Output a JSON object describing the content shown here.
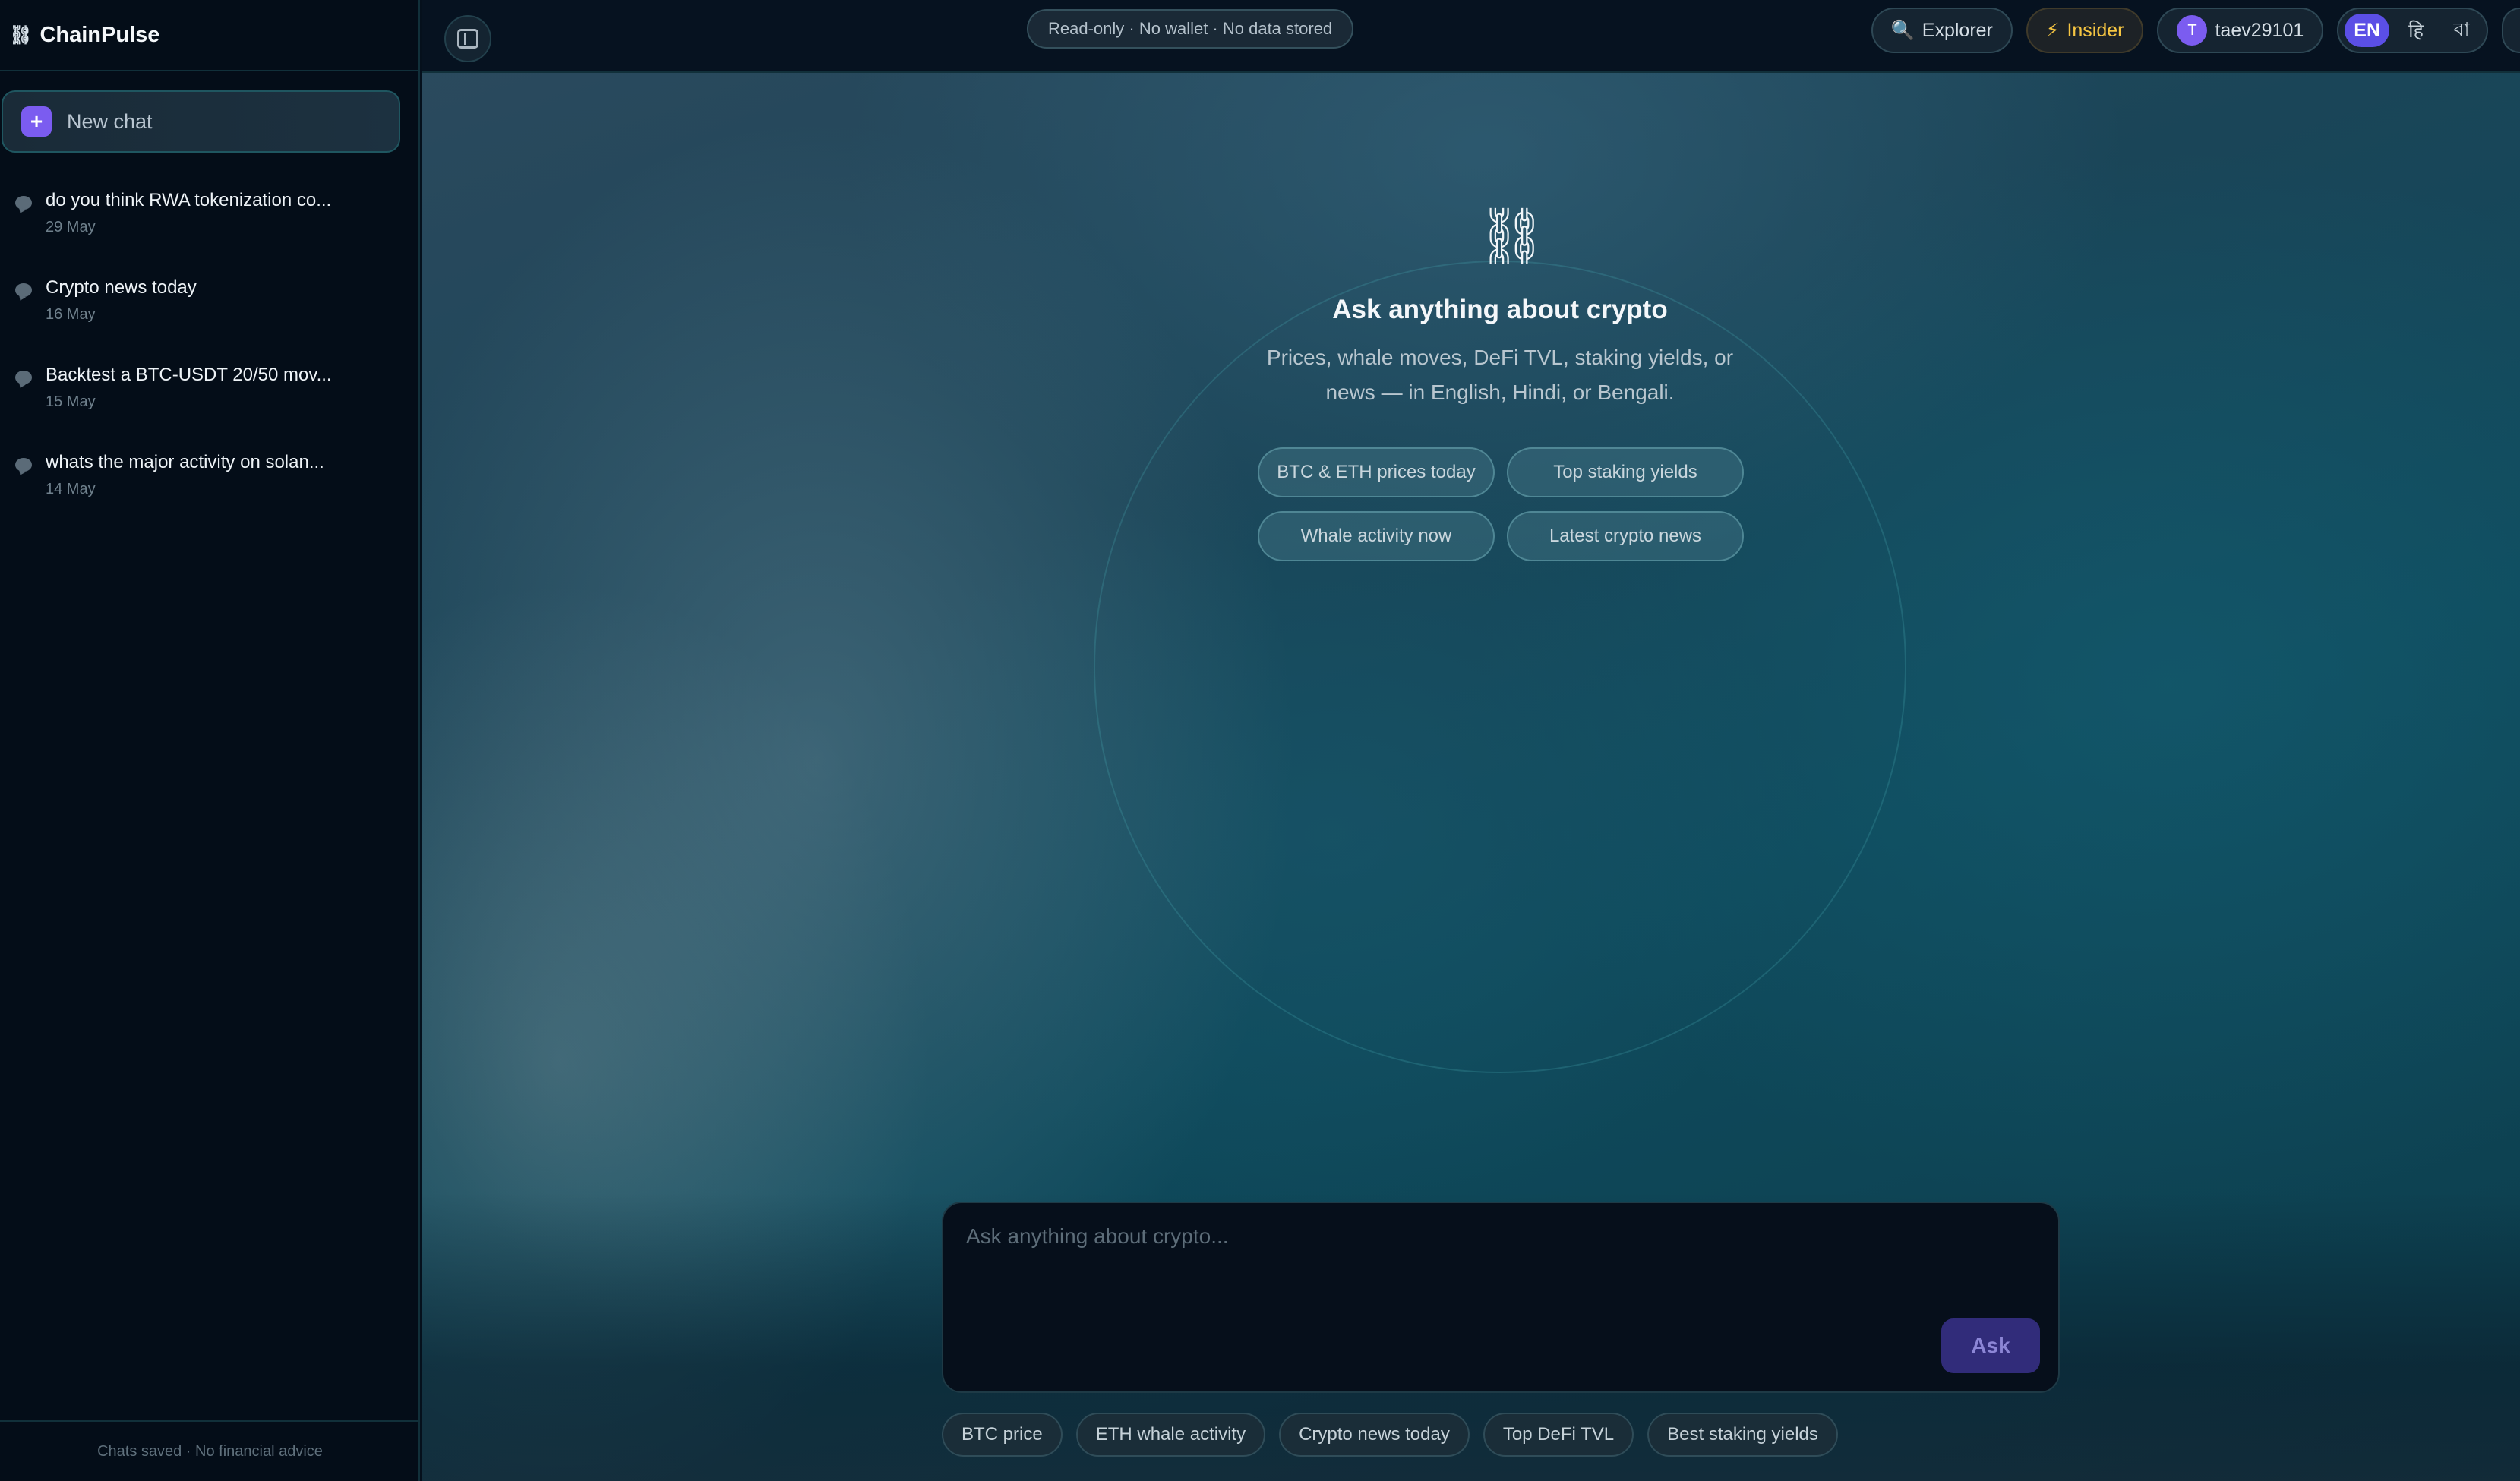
{
  "app": {
    "name": "ChainPulse",
    "logo_icon": "chain-link-icon"
  },
  "sidebar": {
    "new_chat_label": "New chat",
    "history": [
      {
        "title": "do you think RWA tokenization co...",
        "date": "29 May"
      },
      {
        "title": "Crypto news today",
        "date": "16 May"
      },
      {
        "title": "Backtest a BTC-USDT 20/50 mov...",
        "date": "15 May"
      },
      {
        "title": "whats the major activity on solan...",
        "date": "14 May"
      }
    ],
    "footer": "Chats saved · No financial advice"
  },
  "topbar": {
    "status": "Read-only · No wallet · No data stored",
    "explorer_label": "Explorer",
    "explorer_icon": "magnifier-icon",
    "insider_label": "Insider",
    "insider_icon": "lightning-icon",
    "user": {
      "initial": "T",
      "name": "taev29101"
    },
    "languages": [
      "EN",
      "हि",
      "বা"
    ],
    "active_language": "EN"
  },
  "hero": {
    "icon": "⛓",
    "title": "Ask anything about crypto",
    "subtitle": "Prices, whale moves, DeFi TVL, staking yields, or news — in English, Hindi, or Bengali.",
    "suggestions": [
      "BTC & ETH prices today",
      "Top staking yields",
      "Whale activity now",
      "Latest crypto news"
    ]
  },
  "composer": {
    "placeholder": "Ask anything about crypto...",
    "value": "",
    "ask_label": "Ask"
  },
  "quick_chips": [
    "BTC price",
    "ETH whale activity",
    "Crypto news today",
    "Top DeFi TVL",
    "Best staking yields"
  ],
  "colors": {
    "accent": "#7b5cf0",
    "insider": "#f5c542",
    "active_lang": "#5b4fe6"
  }
}
